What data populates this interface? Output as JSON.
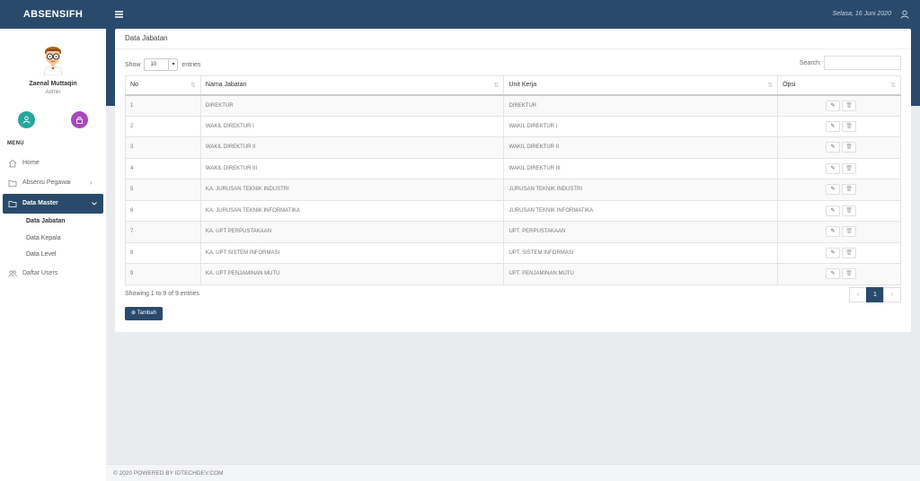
{
  "app": {
    "brand": "ABSENSIFH",
    "date": "Selasa, 16 Juni 2020"
  },
  "user": {
    "name": "Zaenal Muttaqin",
    "role": "Admin"
  },
  "menu": {
    "title": "MENU",
    "items": [
      {
        "label": "Home"
      },
      {
        "label": "Absensi Pegawai"
      },
      {
        "label": "Data Master"
      },
      {
        "label": "Daftar Users"
      }
    ],
    "sub": [
      "Data Jabatan",
      "Data Kepala",
      "Data Level"
    ]
  },
  "card": {
    "title": "Data Jabatan",
    "show_label": "Show",
    "entries_value": "10",
    "entries_label": "entries",
    "search_label": "Search:",
    "search_value": "",
    "columns": [
      "No",
      "Nama Jabatan",
      "Unit Kerja",
      "Opsi"
    ],
    "rows": [
      {
        "no": "1",
        "nama": "DIREKTUR",
        "unit": "DIREKTUR"
      },
      {
        "no": "2",
        "nama": "WAKIL DIREKTUR I",
        "unit": "WAKIL DIREKTUR I"
      },
      {
        "no": "3",
        "nama": "WAKIL DIREKTUR II",
        "unit": "WAKIL DIREKTUR II"
      },
      {
        "no": "4",
        "nama": "WAKIL DIREKTUR III",
        "unit": "WAKIL DIREKTUR III"
      },
      {
        "no": "5",
        "nama": "KA. JURUSAN TEKNIK INDUSTRI",
        "unit": "JURUSAN TEKNIK INDUSTRI"
      },
      {
        "no": "6",
        "nama": "KA. JURUSAN TEKNIK INFORMATIKA",
        "unit": "JURUSAN TEKNIK INFORMATIKA"
      },
      {
        "no": "7",
        "nama": "KA. UPT PERPUSTAKAAN",
        "unit": "UPT. PERPUSTAKAAN"
      },
      {
        "no": "8",
        "nama": "KA. UPT SISTEM INFORMASI",
        "unit": "UPT. SISTEM INFORMASI"
      },
      {
        "no": "9",
        "nama": "KA. UPT PENJAMINAN MUTU",
        "unit": "UPT. PENJAMINAN MUTU"
      }
    ],
    "info": "Showing 1 to 9 of 9 entries",
    "page": "1",
    "add_label": "Tambah"
  },
  "footer": "© 2020 POWERED BY IDTECHDEV.COM",
  "colors": {
    "primary": "#2a4a6b",
    "teal": "#26a69a",
    "purple": "#ab47bc"
  }
}
